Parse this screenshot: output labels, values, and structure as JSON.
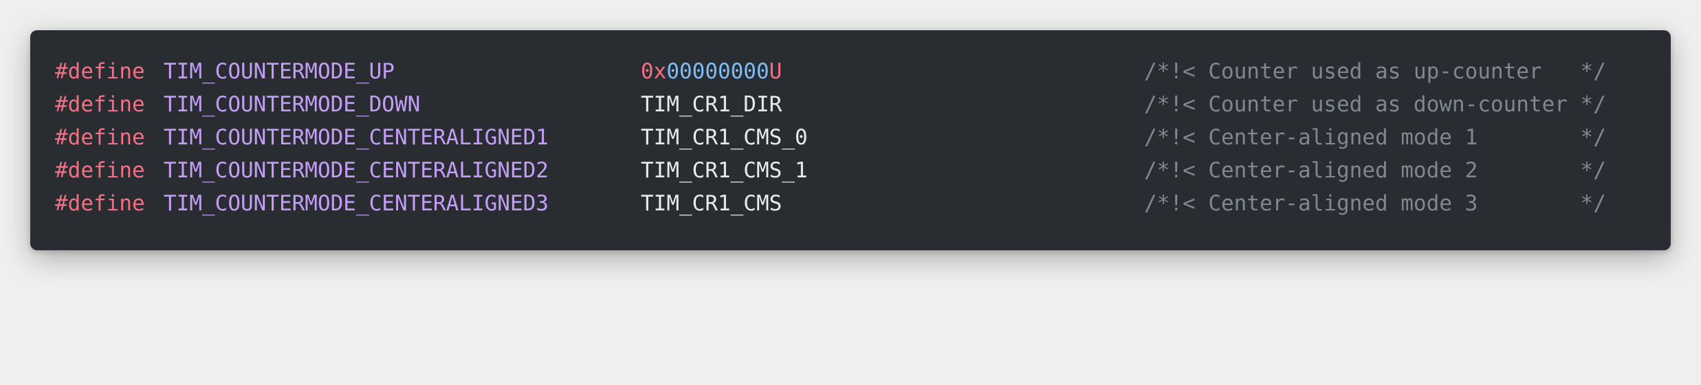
{
  "colors": {
    "page_background": "#efefef",
    "card_background": "#292d31",
    "keyword": "#f46f83",
    "macro_name": "#c49df7",
    "value": "#e8eaed",
    "number": "#7ebcf8",
    "comment": "#7f8791"
  },
  "code": {
    "lines": [
      {
        "keyword": "#define",
        "macro": "TIM_COUNTERMODE_UP",
        "value_prefix": "0x",
        "value_digits": "00000000",
        "value_suffix": "U",
        "comment": "/*!< Counter used as up-counter   */"
      },
      {
        "keyword": "#define",
        "macro": "TIM_COUNTERMODE_DOWN",
        "value": "TIM_CR1_DIR",
        "comment": "/*!< Counter used as down-counter */"
      },
      {
        "keyword": "#define",
        "macro": "TIM_COUNTERMODE_CENTERALIGNED1",
        "value": "TIM_CR1_CMS_0",
        "comment": "/*!< Center-aligned mode 1        */"
      },
      {
        "keyword": "#define",
        "macro": "TIM_COUNTERMODE_CENTERALIGNED2",
        "value": "TIM_CR1_CMS_1",
        "comment": "/*!< Center-aligned mode 2        */"
      },
      {
        "keyword": "#define",
        "macro": "TIM_COUNTERMODE_CENTERALIGNED3",
        "value": "TIM_CR1_CMS",
        "comment": "/*!< Center-aligned mode 3        */"
      }
    ]
  }
}
